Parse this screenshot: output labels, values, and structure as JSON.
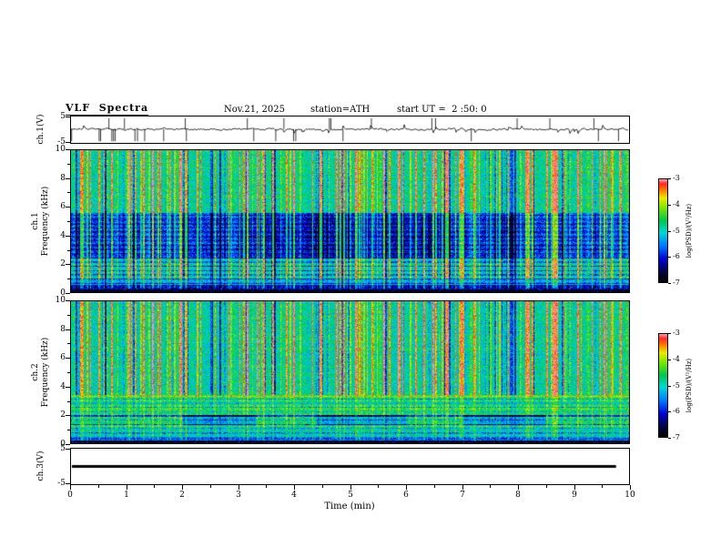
{
  "header": {
    "title": "VLF  Spectra",
    "date": "Nov.21, 2025",
    "station": "station=ATH",
    "start_ut": "start UT =  2 :50: 0"
  },
  "xaxis": {
    "label": "Time (min)",
    "min": 0,
    "max": 10,
    "major_ticks": [
      0,
      1,
      2,
      3,
      4,
      5,
      6,
      7,
      8,
      9,
      10
    ],
    "minor_step": 0.5
  },
  "colorbar": {
    "label": "log(PSD)/(V²/Hz)",
    "ticks": [
      -3,
      -4,
      -5,
      -6,
      -7
    ],
    "min": -7,
    "max": -3
  },
  "chart_data": [
    {
      "type": "line",
      "name": "ch1-waveform",
      "ylabel": "ch.1(V)",
      "ylim": [
        -5,
        5
      ],
      "yticks": [
        5,
        -5
      ],
      "xlim": [
        0,
        10
      ],
      "description": "Broadband VLF time series: noisy baseline near 0 V with frequent impulsive sferic spikes reaching toward -5 V and +5 V across the full 10 minutes."
    },
    {
      "type": "heatmap",
      "name": "ch1-spectrogram",
      "ylabel": "ch.1 Frequency (kHz)",
      "ylabel_line1": "ch.1",
      "ylabel_line2": "Frequency (kHz)",
      "ylim": [
        0,
        10
      ],
      "yticks": [
        0,
        2,
        4,
        6,
        8,
        10
      ],
      "xlim": [
        0,
        10
      ],
      "zlabel": "log(PSD)/(V²/Hz)",
      "zlim": [
        -7,
        -3
      ],
      "features": [
        "dense broadband vertical sferic stripes (green/yellow/red) over full band",
        "suppressed dark-blue band ~2.5-5.5 kHz, darkest near mid-record",
        "black low-power band below ~0.3 kHz",
        "dark horizontal harmonic lines spaced ~0.3 kHz below ~5 kHz",
        "green/cyan background ~ -5 level above 6 kHz"
      ]
    },
    {
      "type": "heatmap",
      "name": "ch2-spectrogram",
      "ylabel": "ch.2 Frequency (kHz)",
      "ylabel_line1": "ch.2",
      "ylabel_line2": "Frequency (kHz)",
      "ylim": [
        0,
        10
      ],
      "yticks": [
        0,
        2,
        4,
        6,
        8,
        10
      ],
      "xlim": [
        0,
        10
      ],
      "zlabel": "log(PSD)/(V²/Hz)",
      "zlim": [
        -7,
        -3
      ],
      "features": [
        "uniform green background with vertical sferic stripes above ~3.5 kHz",
        "bright yellow/orange narrow line near 3.3 kHz",
        "strong dark horizontal lines ~1.2-2.3 kHz with intermittent darker patches",
        "fine horizontal striping below 3.4 kHz",
        "black low-power band below ~0.2 kHz"
      ]
    },
    {
      "type": "line",
      "name": "ch3-waveform",
      "ylabel": "ch.3(V)",
      "ylim": [
        -5,
        5
      ],
      "yticks": [
        5,
        -5
      ],
      "xlim": [
        0,
        10
      ],
      "description": "Flat constant 0 V line (thick black) spanning 0 to ~9.7 min; channel inactive."
    }
  ]
}
